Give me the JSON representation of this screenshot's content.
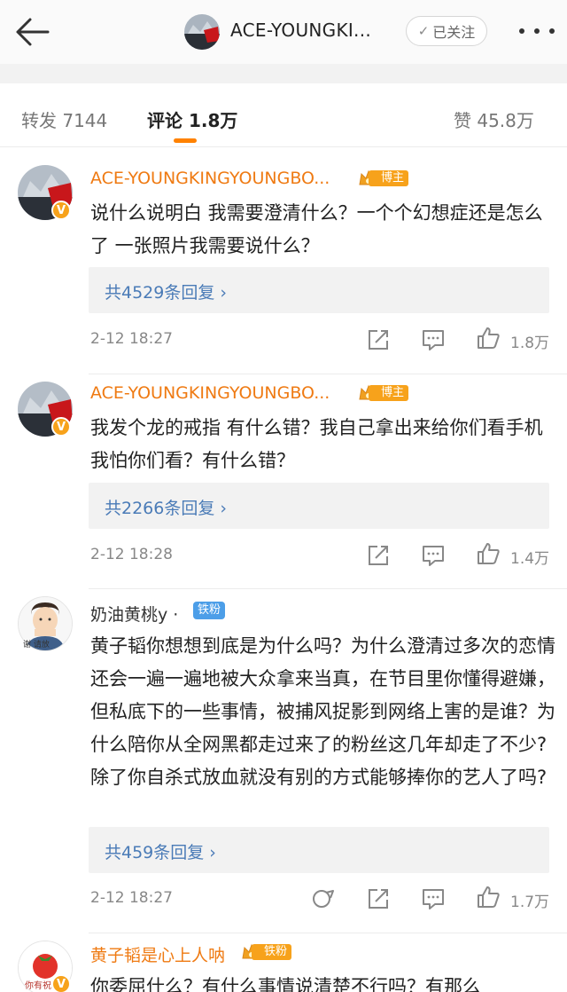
{
  "header": {
    "title": "ACE-YOUNGKI...",
    "follow_label": "已关注",
    "follow_check": "✓"
  },
  "tabs": {
    "repost": "转发 7144",
    "comment": "评论 1.8万",
    "like": "赞 45.8万"
  },
  "comments": [
    {
      "username": "ACE-YOUNGKINGYOUNGBO...",
      "badge": "博主",
      "text": "说什么说明白 我需要澄清什么？一个个幻想症还是怎么了 一张照片我需要说什么？",
      "replies": "共4529条回复 ›",
      "time": "2-12 18:27",
      "likes": "1.8万"
    },
    {
      "username": "ACE-YOUNGKINGYOUNGBO...",
      "badge": "博主",
      "text": "我发个龙的戒指 有什么错？我自己拿出来给你们看手机我怕你们看？有什么错？",
      "replies": "共2266条回复 ›",
      "time": "2-12 18:28",
      "likes": "1.4万"
    },
    {
      "username": "奶油黄桃y ·",
      "badge": "铁粉",
      "avatar_caption": "谢 请放",
      "text": "黄子韬你想想到底是为什么吗？为什么澄清过多次的恋情还会一遍一遍地被大众拿来当真，在节目里你懂得避嫌，但私底下的一些事情，被捕风捉影到网络上害的是谁？为什么陪你从全网黑都走过来了的粉丝这几年却走了不少?除了你自杀式放血就没有别的方式能够捧你的艺人了吗?",
      "replies": "共459条回复 ›",
      "time": "2-12 18:27",
      "likes": "1.7万"
    },
    {
      "username": "黄子韬是心上人呐",
      "badge": "铁粉",
      "avatar_caption": "你有祝",
      "text": "你委屈什么？有什么事情说清楚不行吗？有那么"
    }
  ],
  "colors": {
    "accent": "#ff8200",
    "username_orange": "#ef7a12",
    "link_blue": "#4a7bb7",
    "iron_fan_blue": "#4c9ee8",
    "verified_gold": "#f7a21b"
  }
}
